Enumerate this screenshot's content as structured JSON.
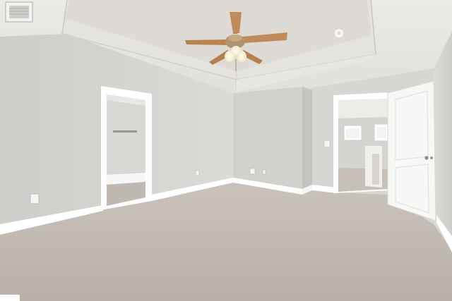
{
  "scene": {
    "description_type": "photo",
    "subject": "empty-bedroom-interior",
    "colors": {
      "ceiling": "#e7e5e2",
      "wall_left": "#d6d4d1",
      "wall_back": "#d1cfcc",
      "trim": "#ffffff",
      "carpet": "#c2bbb3",
      "fan_blade": "#c08a5a",
      "fan_metal": "#a8895f"
    }
  },
  "badge": {
    "label": ""
  }
}
